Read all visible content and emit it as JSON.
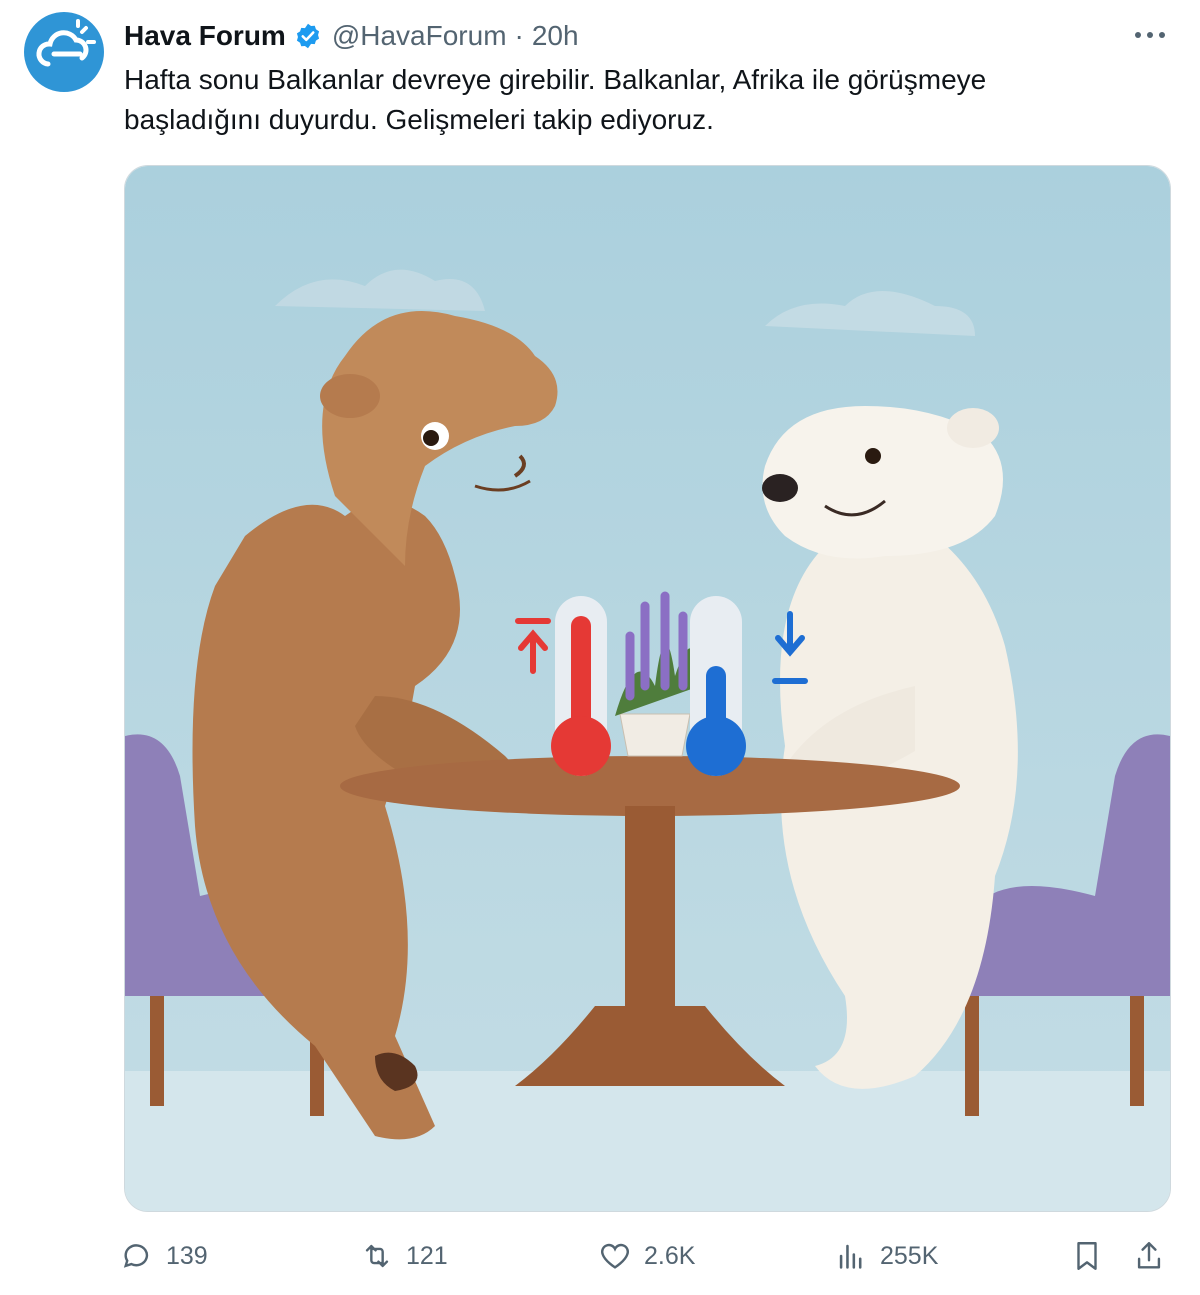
{
  "tweet": {
    "author_name": "Hava Forum",
    "handle": "@HavaForum",
    "separator": "·",
    "time": "20h",
    "text": "Hafta sonu Balkanlar devreye girebilir. Balkanlar, Afrika ile görüşmeye başladığını duyurdu. Gelişmeleri takip ediyoruz."
  },
  "icons": {
    "avatar": "cloud-sun-logo",
    "verified": "verified-badge-icon",
    "more": "more-options-icon",
    "reply": "reply-icon",
    "retweet": "retweet-icon",
    "like": "heart-icon",
    "views": "views-bar-chart-icon",
    "bookmark": "bookmark-icon",
    "share": "share-icon"
  },
  "actions": {
    "replies": "139",
    "retweets": "121",
    "likes": "2.6K",
    "views": "255K"
  },
  "colors": {
    "verified": "#1d9bf0",
    "avatar_bg": "#2f95d6",
    "sky": "#b6d8e3",
    "text_secondary": "#536471"
  }
}
